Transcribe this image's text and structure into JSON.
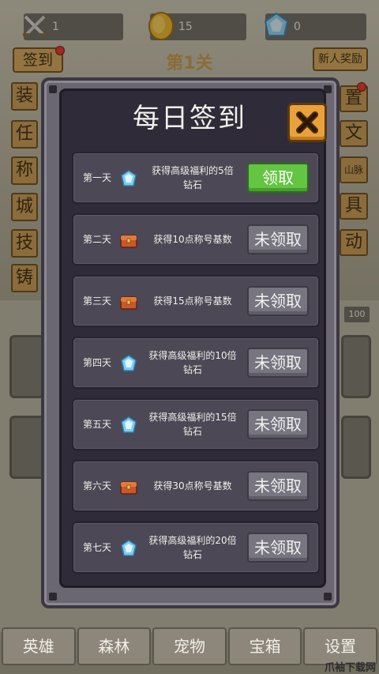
{
  "header": {
    "swords_value": "1",
    "gold_value": "15",
    "gems_value": "0",
    "stage_title": "第1关",
    "checkin_tab": "签到",
    "newbie_reward": "新人奖励"
  },
  "side_left": [
    "装",
    "任",
    "称",
    "城",
    "技",
    "铸"
  ],
  "side_right": [
    "置",
    "文",
    "山脉",
    "具",
    "动"
  ],
  "bg_number": "100",
  "modal": {
    "title": "每日签到",
    "rows": [
      {
        "day": "第一天",
        "icon": "diamond-icon",
        "reward_line1": "获得高级福利的5倍",
        "reward_line2": "钻石",
        "button": "领取",
        "claimable": true
      },
      {
        "day": "第二天",
        "icon": "chest-icon",
        "reward_line1": "获得10点称号基数",
        "reward_line2": "",
        "button": "未领取",
        "claimable": false
      },
      {
        "day": "第三天",
        "icon": "chest-icon",
        "reward_line1": "获得15点称号基数",
        "reward_line2": "",
        "button": "未领取",
        "claimable": false
      },
      {
        "day": "第四天",
        "icon": "diamond-icon",
        "reward_line1": "获得高级福利的10倍",
        "reward_line2": "钻石",
        "button": "未领取",
        "claimable": false
      },
      {
        "day": "第五天",
        "icon": "diamond-icon",
        "reward_line1": "获得高级福利的15倍",
        "reward_line2": "钻石",
        "button": "未领取",
        "claimable": false
      },
      {
        "day": "第六天",
        "icon": "chest-icon",
        "reward_line1": "获得30点称号基数",
        "reward_line2": "",
        "button": "未领取",
        "claimable": false
      },
      {
        "day": "第七天",
        "icon": "diamond-icon",
        "reward_line1": "获得高级福利的20倍",
        "reward_line2": "钻石",
        "button": "未领取",
        "claimable": false
      }
    ]
  },
  "bottom_nav": [
    "英雄",
    "森林",
    "宠物",
    "宝箱",
    "设置"
  ],
  "watermark": "爪袖下载网",
  "colors": {
    "claim_green": "#63c542",
    "unclaimed_gray": "#777580",
    "close_orange": "#e9a23b",
    "panel_dark": "#2f2b38"
  }
}
